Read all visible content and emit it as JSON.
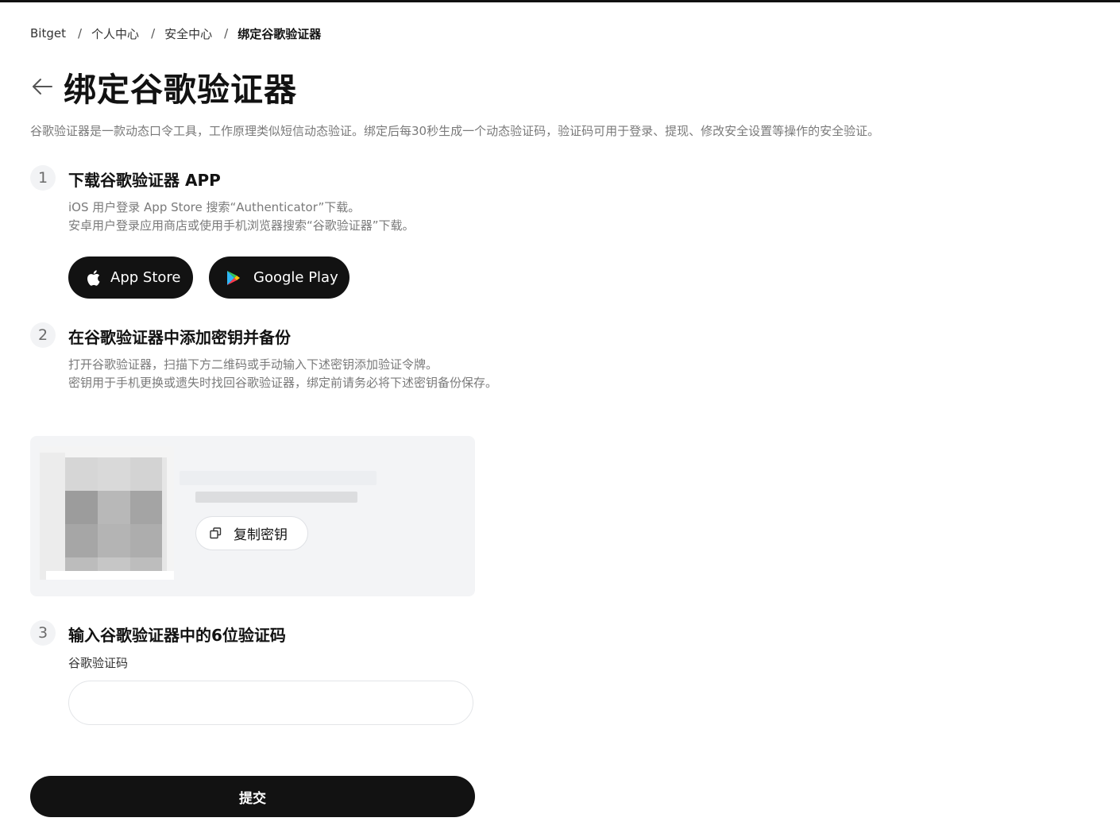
{
  "breadcrumb": [
    "Bitget",
    "个人中心",
    "安全中心",
    "绑定谷歌验证器"
  ],
  "page": {
    "title": "绑定谷歌验证器",
    "description": "谷歌验证器是一款动态口令工具，工作原理类似短信动态验证。绑定后每30秒生成一个动态验证码，验证码可用于登录、提现、修改安全设置等操作的安全验证。"
  },
  "steps": [
    {
      "number": "1",
      "title": "下载谷歌验证器 APP",
      "desc_lines": [
        "iOS 用户登录 App Store 搜索“Authenticator”下载。",
        "安卓用户登录应用商店或使用手机浏览器搜索“谷歌验证器”下载。"
      ]
    },
    {
      "number": "2",
      "title": "在谷歌验证器中添加密钥并备份",
      "desc_lines": [
        "打开谷歌验证器，扫描下方二维码或手动输入下述密钥添加验证令牌。",
        "密钥用于手机更换或遗失时找回谷歌验证器，绑定前请务必将下述密钥备份保存。"
      ]
    },
    {
      "number": "3",
      "title": "输入谷歌验证器中的6位验证码"
    }
  ],
  "stores": {
    "app_store_label": "App Store",
    "google_play_label": "Google Play"
  },
  "key_card": {
    "copy_label": "复制密钥"
  },
  "code_field": {
    "label": "谷歌验证码",
    "value": "",
    "placeholder": ""
  },
  "submit_label": "提交",
  "colors": {
    "primary": "#121212",
    "card_bg": "#f3f4f6",
    "muted_text": "#7a7a7a"
  },
  "icons": {
    "back": "arrow-left-icon",
    "apple": "apple-icon",
    "google_play": "google-play-icon",
    "copy": "copy-icon"
  }
}
